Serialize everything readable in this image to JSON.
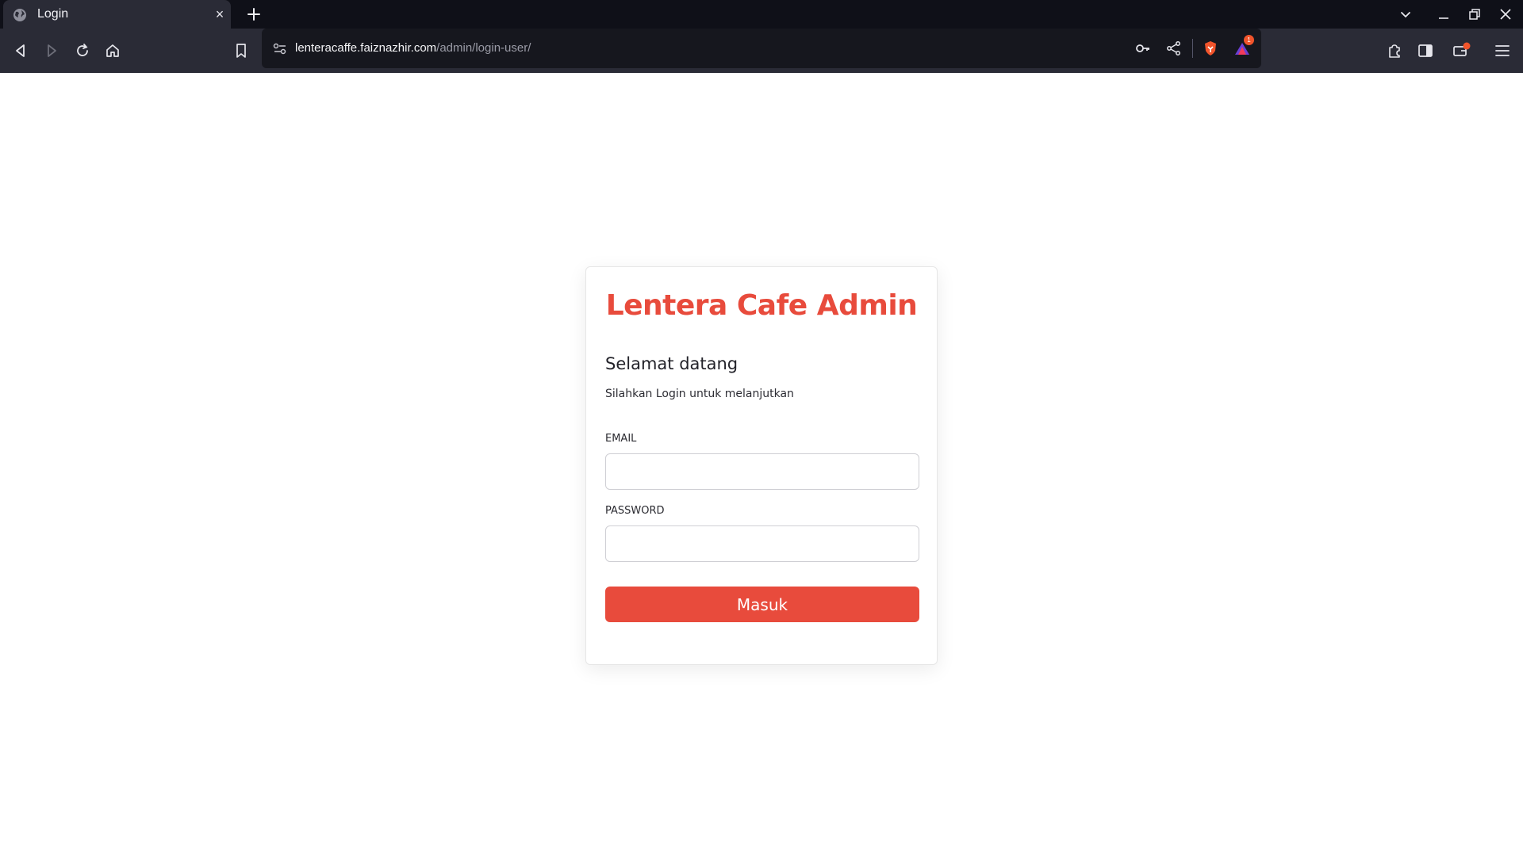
{
  "browser": {
    "tab": {
      "title": "Login",
      "favicon": "globe-icon",
      "close": "×"
    },
    "toolbar": {
      "url_domain": "lenteracaffe.faiznazhir.com",
      "url_path": "/admin/login-user/",
      "rewards_badge": "1"
    }
  },
  "login": {
    "title": "Lentera Cafe Admin",
    "welcome": "Selamat datang",
    "subtitle": "Silahkan Login untuk melanjutkan",
    "email_label": "EMAIL",
    "email_value": "",
    "password_label": "PASSWORD",
    "password_value": "",
    "submit_label": "Masuk"
  },
  "colors": {
    "accent": "#e84b3c",
    "chrome_dark": "#0f1018",
    "chrome_toolbar": "#2a2b36",
    "urlbar": "#16171e"
  }
}
